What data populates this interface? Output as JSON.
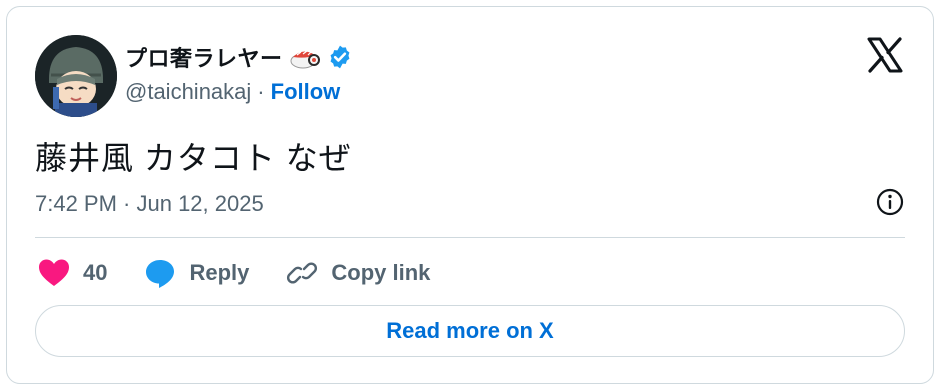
{
  "author": {
    "display_name": "プロ奢ラレヤー",
    "handle": "@taichinakaj",
    "separator": "·",
    "follow_label": "Follow"
  },
  "tweet": {
    "text": "藤井風 カタコト なぜ",
    "timestamp": "7:42 PM · Jun 12, 2025"
  },
  "actions": {
    "likes_count": "40",
    "reply_label": "Reply",
    "copy_link_label": "Copy link"
  },
  "read_more_label": "Read more on X",
  "colors": {
    "link_blue": "#006fd6",
    "like_pink": "#f91880",
    "reply_blue": "#1d9bf0",
    "muted": "#536471",
    "border": "#cfd9de"
  },
  "icons": [
    "sushi-emoji-icon",
    "verified-badge-icon",
    "x-logo-icon",
    "info-icon",
    "heart-icon",
    "reply-bubble-icon",
    "link-icon"
  ]
}
